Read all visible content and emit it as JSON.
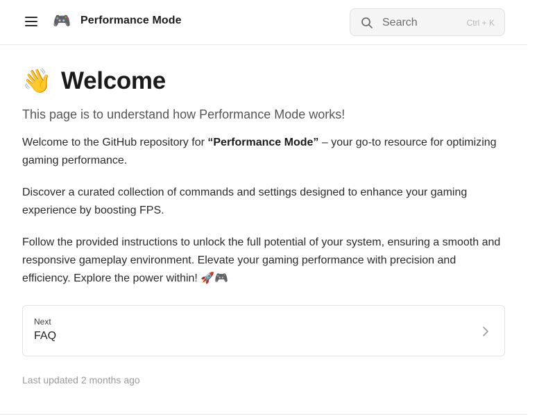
{
  "header": {
    "menu_icon": "hamburger-menu-icon",
    "logo_icon": "gamepad-icon",
    "logo_glyph": "🎮",
    "site_title": "Performance Mode",
    "search": {
      "icon": "search-icon",
      "placeholder": "Search",
      "shortcut": "Ctrl + K"
    }
  },
  "page": {
    "title_icon": "waving-hand-icon",
    "title_glyph": "👋",
    "title": "Welcome",
    "subtitle": "This page is to understand how Performance Mode works!",
    "paragraph1": {
      "before": "Welcome to the GitHub repository for ",
      "bold": "“Performance Mode”",
      "after": " – your go-to resource for optimizing gaming performance."
    },
    "paragraph2": "Discover a curated collection of commands and settings designed to enhance your gaming experience by boosting FPS.",
    "paragraph3": "Follow the provided instructions to unlock the full potential of your system, ensuring a smooth and responsive gameplay environment. Elevate your gaming performance with precision and efficiency. Explore the power within! 🚀🎮"
  },
  "pagination": {
    "next_label": "Next",
    "next_title": "FAQ",
    "icon": "chevron-right-icon"
  },
  "footer": {
    "last_updated": "Last updated 2 months ago"
  },
  "colors": {
    "text": "#1f1f1f",
    "muted": "#9a9a9a",
    "border": "#e2e2e2",
    "search_bg": "#f5f5f5"
  }
}
